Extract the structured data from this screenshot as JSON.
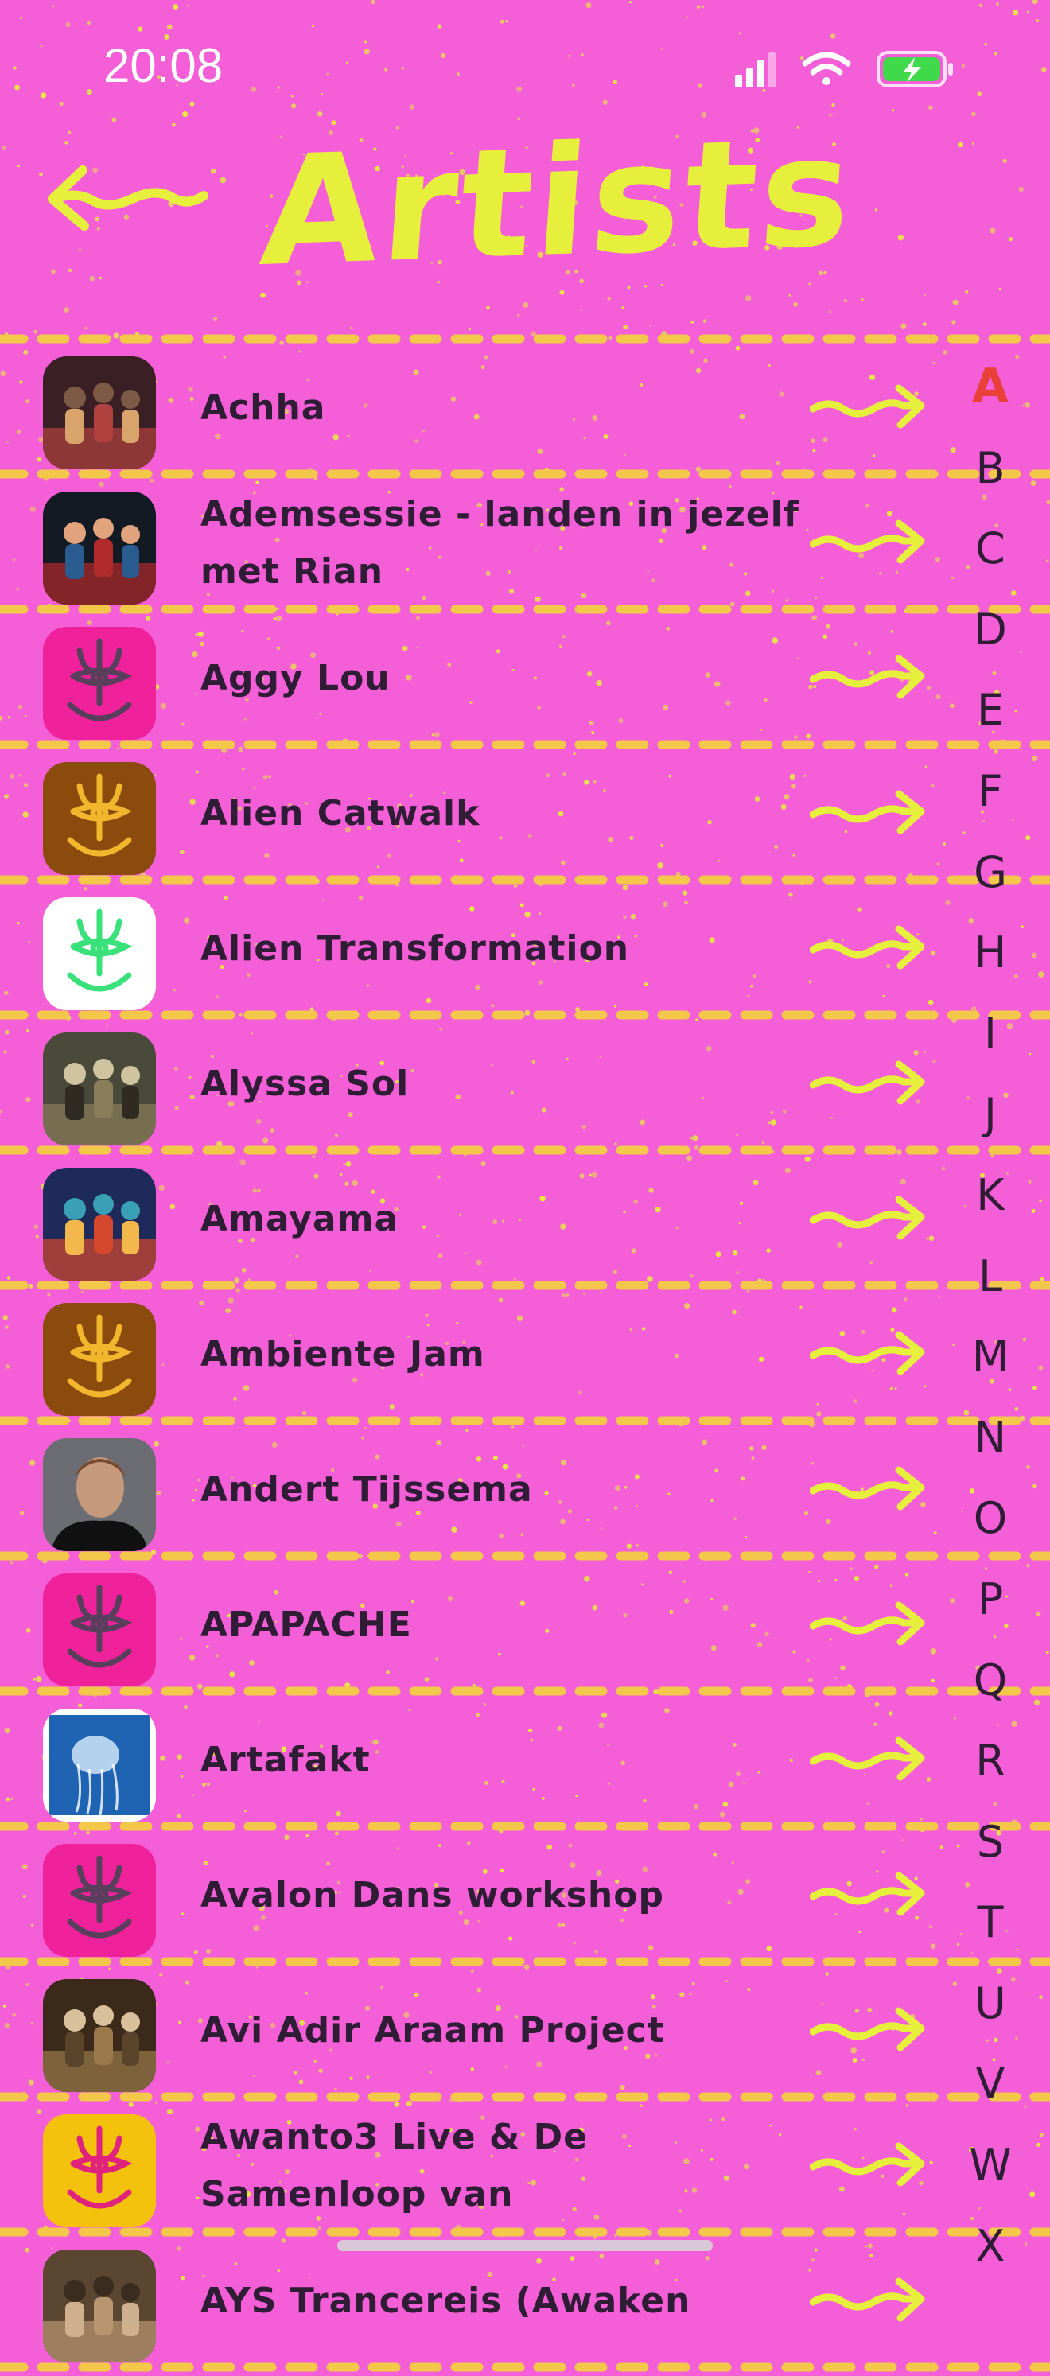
{
  "status_bar": {
    "time": "20:08"
  },
  "header": {
    "title": "Artists"
  },
  "colors": {
    "background": "#f45fd8",
    "accent_yellow": "#e6ef3c",
    "text": "#2f1c35",
    "index_active": "#e9403a",
    "logo_pink": "#f0229b",
    "logo_brown": "#8a4b0c",
    "logo_white": "#ffffff",
    "logo_yellow": "#f4c20c"
  },
  "artists": [
    {
      "name": "Achha",
      "avatar": "photo-band-stage"
    },
    {
      "name": "Ademsessie - landen in jezelf met Rian",
      "avatar": "photo-woman-red-hair"
    },
    {
      "name": "Aggy Lou",
      "avatar": "logo-pink"
    },
    {
      "name": "Alien Catwalk",
      "avatar": "logo-brown"
    },
    {
      "name": "Alien Transformation",
      "avatar": "logo-white-green"
    },
    {
      "name": "Alyssa Sol",
      "avatar": "photo-guitarist-forest"
    },
    {
      "name": "Amayama",
      "avatar": "photo-band-colorful"
    },
    {
      "name": "Ambiente Jam",
      "avatar": "logo-brown"
    },
    {
      "name": "Andert Tijssema",
      "avatar": "photo-man-portrait"
    },
    {
      "name": "APAPACHE",
      "avatar": "logo-pink"
    },
    {
      "name": "Artafakt",
      "avatar": "photo-jellyfish-blue"
    },
    {
      "name": "Avalon Dans workshop",
      "avatar": "logo-pink"
    },
    {
      "name": "Avi Adir Araam Project",
      "avatar": "photo-musicians-sepia"
    },
    {
      "name": "Awanto3 Live & De Samenloop van",
      "avatar": "logo-yellow"
    },
    {
      "name": "AYS Trancereis (Awaken",
      "avatar": "photo-partial"
    }
  ],
  "index": {
    "active": "A",
    "letters": [
      "A",
      "B",
      "C",
      "D",
      "E",
      "F",
      "G",
      "H",
      "I",
      "J",
      "K",
      "L",
      "M",
      "N",
      "O",
      "P",
      "Q",
      "R",
      "S",
      "T",
      "U",
      "V",
      "W",
      "X"
    ]
  }
}
